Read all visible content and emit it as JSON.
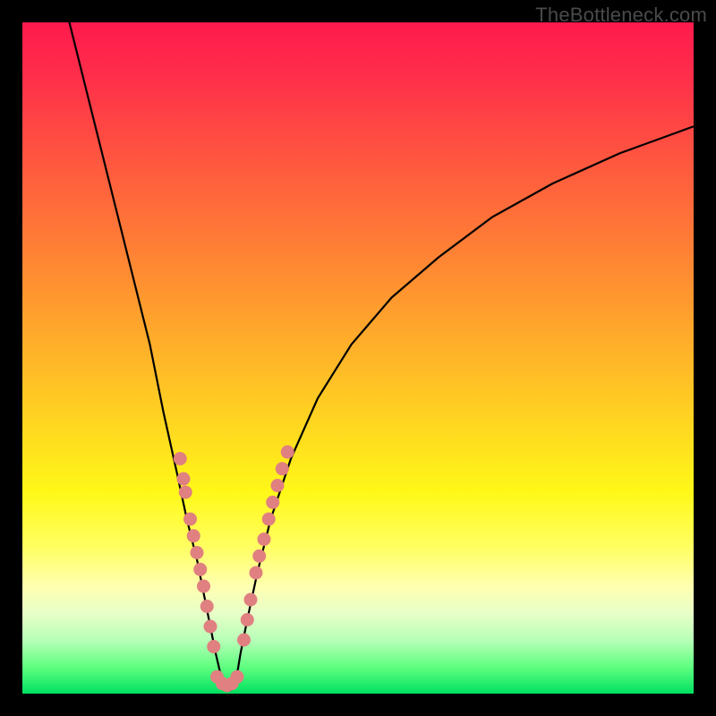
{
  "watermark": "TheBottleneck.com",
  "chart_data": {
    "type": "line",
    "title": "",
    "xlabel": "",
    "ylabel": "",
    "xlim": [
      0,
      100
    ],
    "ylim": [
      0,
      100
    ],
    "grid": false,
    "legend": false,
    "series": [
      {
        "name": "bottleneck-curve",
        "color": "#000000",
        "x": [
          7,
          10,
          13,
          16,
          19,
          21,
          23,
          24.5,
          26,
          27,
          28,
          28.8,
          29.5,
          30,
          30.5,
          31,
          31.5,
          32,
          32.5,
          33.5,
          35,
          37,
          40,
          44,
          49,
          55,
          62,
          70,
          79,
          89,
          100
        ],
        "y": [
          100,
          88,
          76,
          64,
          52,
          42,
          33,
          26,
          20,
          15,
          10,
          6,
          3,
          1,
          0.5,
          0.5,
          1,
          3,
          6,
          11,
          18,
          26,
          35,
          44,
          52,
          59,
          65,
          71,
          76,
          80.5,
          84.5
        ]
      }
    ],
    "markers": [
      {
        "name": "left-dots",
        "color": "#e08080",
        "points": [
          {
            "x": 23.5,
            "y": 35
          },
          {
            "x": 24.0,
            "y": 32
          },
          {
            "x": 24.3,
            "y": 30
          },
          {
            "x": 25.0,
            "y": 26
          },
          {
            "x": 25.5,
            "y": 23.5
          },
          {
            "x": 26.0,
            "y": 21
          },
          {
            "x": 26.5,
            "y": 18.5
          },
          {
            "x": 27.0,
            "y": 16
          },
          {
            "x": 27.5,
            "y": 13
          },
          {
            "x": 28.0,
            "y": 10
          },
          {
            "x": 28.5,
            "y": 7
          }
        ]
      },
      {
        "name": "right-dots",
        "color": "#e08080",
        "points": [
          {
            "x": 33.0,
            "y": 8
          },
          {
            "x": 33.5,
            "y": 11
          },
          {
            "x": 34.0,
            "y": 14
          },
          {
            "x": 34.8,
            "y": 18
          },
          {
            "x": 35.3,
            "y": 20.5
          },
          {
            "x": 36.0,
            "y": 23
          },
          {
            "x": 36.7,
            "y": 26
          },
          {
            "x": 37.3,
            "y": 28.5
          },
          {
            "x": 38.0,
            "y": 31
          },
          {
            "x": 38.7,
            "y": 33.5
          },
          {
            "x": 39.5,
            "y": 36
          }
        ]
      },
      {
        "name": "bottom-dots",
        "color": "#e08080",
        "points": [
          {
            "x": 29.0,
            "y": 2.5
          },
          {
            "x": 29.8,
            "y": 1.5
          },
          {
            "x": 30.5,
            "y": 1.2
          },
          {
            "x": 31.2,
            "y": 1.5
          },
          {
            "x": 32.0,
            "y": 2.5
          }
        ]
      }
    ]
  }
}
